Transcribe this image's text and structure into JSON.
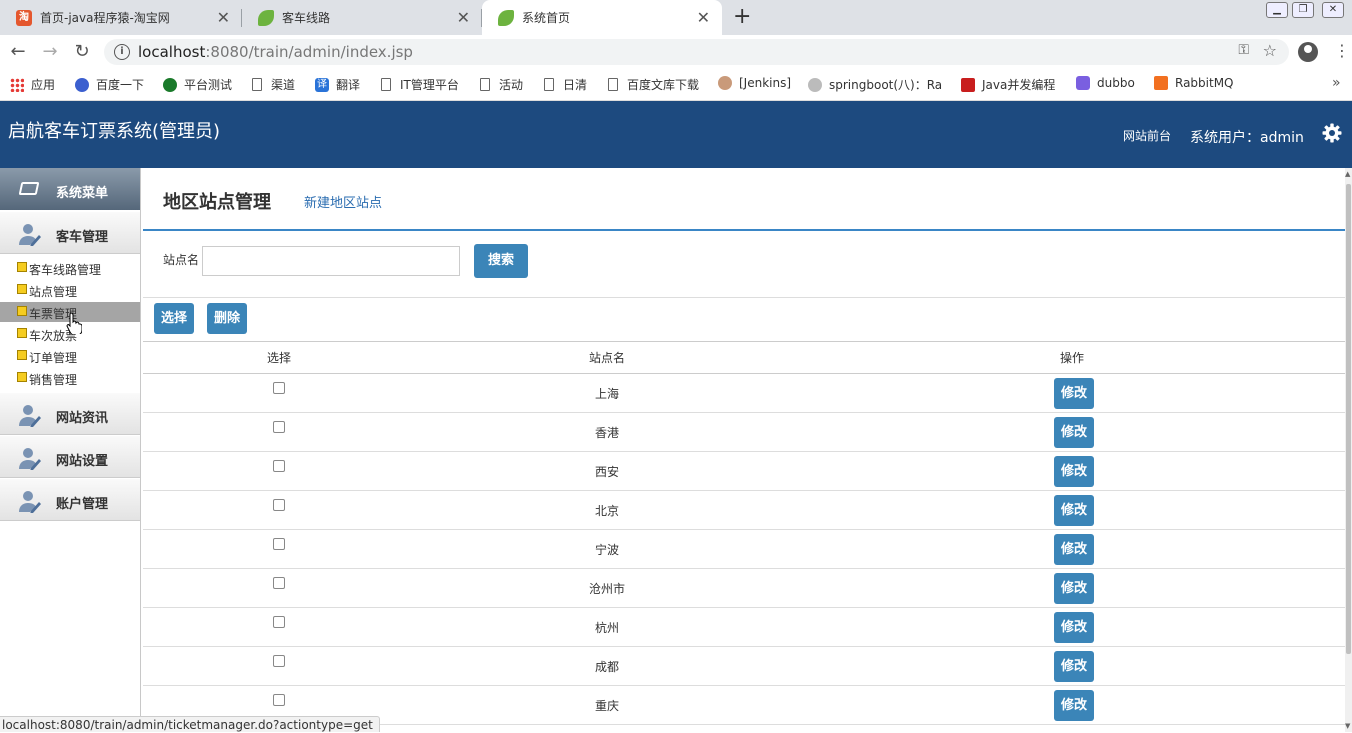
{
  "browser": {
    "tabs": [
      {
        "title": "首页-java程序猿-淘宝网",
        "icon": "taobao-icon",
        "fav_text": "淘"
      },
      {
        "title": "客车线路",
        "icon": "spring-leaf-icon"
      },
      {
        "title": "系统首页",
        "icon": "spring-leaf-icon"
      }
    ],
    "url_host": "localhost",
    "url_rest": ":8080/train/admin/index.jsp",
    "bookmarks": [
      {
        "label": "应用",
        "icon": "apps-icon"
      },
      {
        "label": "百度一下",
        "icon": "baidu-icon"
      },
      {
        "label": "平台测试",
        "icon": "globe-icon"
      },
      {
        "label": "渠道",
        "icon": "page-icon"
      },
      {
        "label": "翻译",
        "icon": "translate-icon",
        "glyph": "译"
      },
      {
        "label": "IT管理平台",
        "icon": "page-icon"
      },
      {
        "label": "活动",
        "icon": "page-icon"
      },
      {
        "label": "日清",
        "icon": "page-icon"
      },
      {
        "label": "百度文库下载",
        "icon": "page-icon"
      },
      {
        "label": "[Jenkins]",
        "icon": "jenkins-icon"
      },
      {
        "label": "springboot(八)：Ra",
        "icon": "blog-icon"
      },
      {
        "label": "Java并发编程",
        "icon": "c-icon"
      },
      {
        "label": "dubbo",
        "icon": "dubbo-icon"
      },
      {
        "label": "RabbitMQ",
        "icon": "rabbitmq-icon"
      }
    ],
    "status_url": "localhost:8080/train/admin/ticketmanager.do?actiontype=get"
  },
  "header": {
    "title": "启航客车订票系统(管理员)",
    "front_link": "网站前台",
    "user_label": "系统用户：admin"
  },
  "sidebar": {
    "menu_title": "系统菜单",
    "sections": [
      {
        "label": "客车管理"
      },
      {
        "label": "网站资讯"
      },
      {
        "label": "网站设置"
      },
      {
        "label": "账户管理"
      }
    ],
    "items": [
      {
        "label": "客车线路管理"
      },
      {
        "label": "站点管理"
      },
      {
        "label": "车票管理"
      },
      {
        "label": "车次放票"
      },
      {
        "label": "订单管理"
      },
      {
        "label": "销售管理"
      }
    ]
  },
  "main": {
    "title": "地区站点管理",
    "new_link": "新建地区站点",
    "search_label": "站点名",
    "search_value": "",
    "search_button": "搜索",
    "select_button": "选择",
    "delete_button": "删除",
    "columns": [
      "选择",
      "站点名",
      "操作"
    ],
    "edit_label": "修改",
    "rows": [
      {
        "name": "上海"
      },
      {
        "name": "香港"
      },
      {
        "name": "西安"
      },
      {
        "name": "北京"
      },
      {
        "name": "宁波"
      },
      {
        "name": "沧州市"
      },
      {
        "name": "杭州"
      },
      {
        "name": "成都"
      },
      {
        "name": "重庆"
      }
    ]
  },
  "colors": {
    "header_bg": "#1d4a7f",
    "button_bg": "#3b85b8",
    "link": "#2a6cb0",
    "rule": "#3a86c6"
  }
}
